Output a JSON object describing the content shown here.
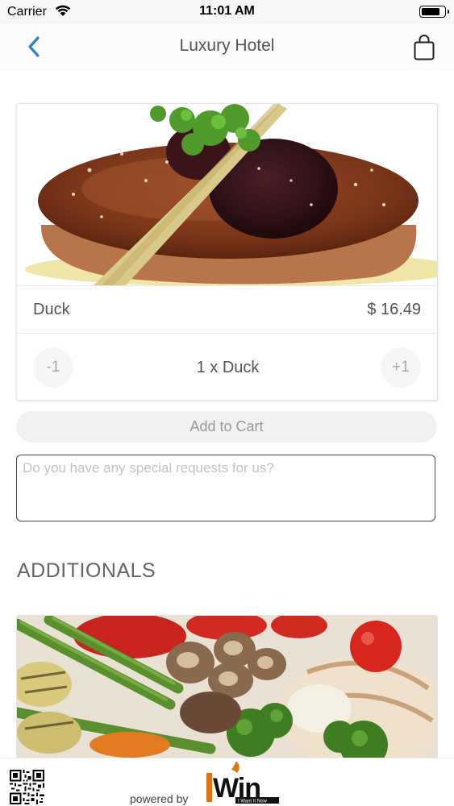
{
  "status_bar": {
    "carrier": "Carrier",
    "time": "11:01 AM",
    "battery_level": 0.85
  },
  "nav": {
    "title": "Luxury Hotel",
    "back_icon": "chevron-left-icon",
    "cart_icon": "shopping-bag-icon",
    "accent_color": "#2d7fd6"
  },
  "product": {
    "name": "Duck",
    "price": "$ 16.49",
    "minus_label": "-1",
    "plus_label": "+1",
    "quantity_summary": "1 x Duck"
  },
  "add_to_cart_label": "Add to Cart",
  "requests": {
    "placeholder": "Do you have any special requests for us?",
    "value": ""
  },
  "additionals": {
    "title": "ADDITIONALS"
  },
  "footer": {
    "powered_by": "powered by",
    "brand_logo_text": "IWin",
    "brand_tagline": "I Want It Now",
    "brand_color": "#e8730c"
  }
}
